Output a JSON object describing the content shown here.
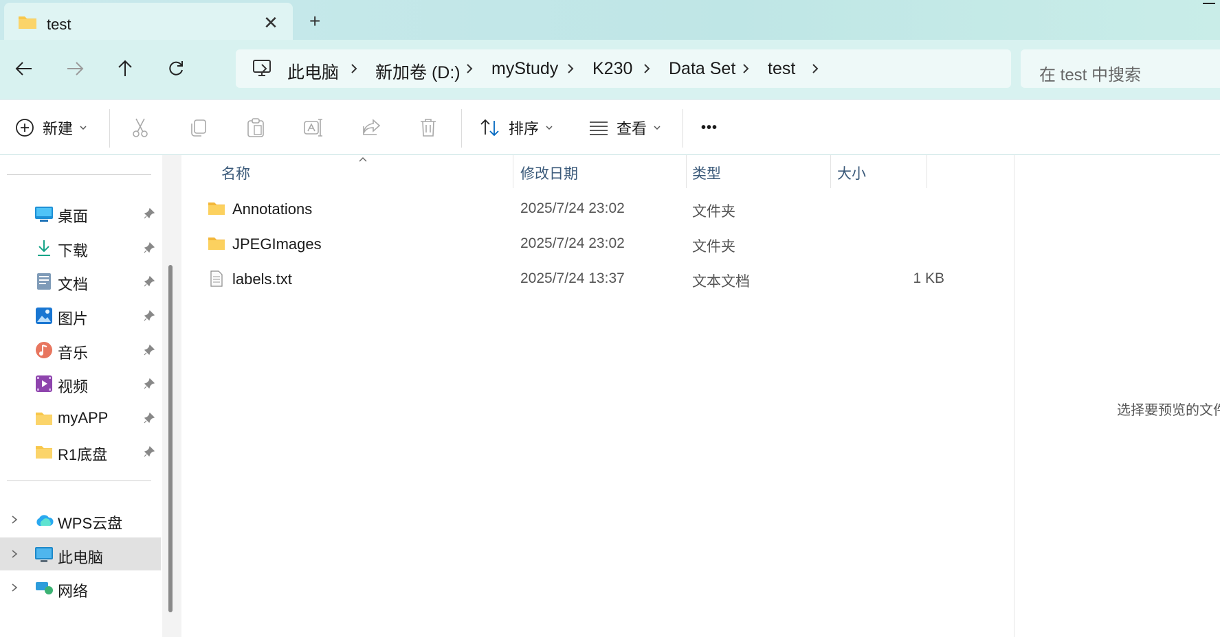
{
  "tab": {
    "title": "test",
    "close_glyph": "✕",
    "new_tab_glyph": "+"
  },
  "nav": {
    "back_icon": "arrow-left-icon",
    "forward_icon": "arrow-right-icon",
    "up_icon": "arrow-up-icon",
    "refresh_icon": "refresh-icon",
    "breadcrumb": [
      "此电脑",
      "新加卷 (D:)",
      "myStudy",
      "K230",
      "Data Set",
      "test"
    ],
    "search_placeholder": "在 test 中搜索"
  },
  "commands": {
    "new": "新建",
    "cut_icon": "scissors-icon",
    "copy_icon": "copy-icon",
    "paste_icon": "clipboard-icon",
    "rename_icon": "rename-icon",
    "share_icon": "share-icon",
    "delete_icon": "trash-icon",
    "sort": "排序",
    "view": "查看",
    "more_glyph": "•••"
  },
  "sidebar": {
    "quick_access": [
      {
        "label": "桌面",
        "icon": "desktop-icon",
        "pinned": true
      },
      {
        "label": "下载",
        "icon": "download-icon",
        "pinned": true
      },
      {
        "label": "文档",
        "icon": "document-icon",
        "pinned": true
      },
      {
        "label": "图片",
        "icon": "picture-icon",
        "pinned": true
      },
      {
        "label": "音乐",
        "icon": "music-icon",
        "pinned": true
      },
      {
        "label": "视频",
        "icon": "video-icon",
        "pinned": true
      },
      {
        "label": "myAPP",
        "icon": "folder-icon",
        "pinned": true
      },
      {
        "label": "R1底盘",
        "icon": "folder-icon",
        "pinned": true
      }
    ],
    "locations": [
      {
        "label": "WPS云盘",
        "icon": "cloud-icon"
      },
      {
        "label": "此电脑",
        "icon": "computer-icon",
        "selected": true
      },
      {
        "label": "网络",
        "icon": "network-icon"
      }
    ]
  },
  "columns": {
    "name": "名称",
    "modified": "修改日期",
    "type": "类型",
    "size": "大小"
  },
  "files": [
    {
      "name": "Annotations",
      "modified": "2025/7/24 23:02",
      "type": "文件夹",
      "size": "",
      "icon": "folder-icon"
    },
    {
      "name": "JPEGImages",
      "modified": "2025/7/24 23:02",
      "type": "文件夹",
      "size": "",
      "icon": "folder-icon"
    },
    {
      "name": "labels.txt",
      "modified": "2025/7/24 13:37",
      "type": "文本文档",
      "size": "1 KB",
      "icon": "text-file-icon"
    }
  ],
  "preview": {
    "message": "选择要预览的文件。"
  },
  "colors": {
    "titlebar": "#c9e9ec",
    "addressbar": "#d8f2f0",
    "accent": "#0067c0",
    "folder": "#f8c74a"
  }
}
